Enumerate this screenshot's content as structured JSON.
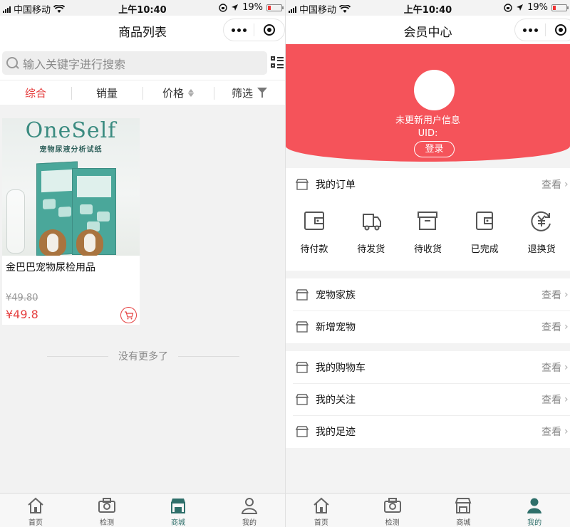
{
  "status": {
    "carrier": "中国移动",
    "time": "上午10:40",
    "battery": "19%"
  },
  "left": {
    "nav_title": "商品列表",
    "search_placeholder": "输入关键字进行搜索",
    "sort_tabs": [
      "综合",
      "销量",
      "价格",
      "筛选"
    ],
    "product": {
      "image_brand": "OneSelf",
      "image_subtitle": "宠物尿液分析试纸",
      "name": "金巴巴宠物尿检用品",
      "old_price": "¥49.80",
      "price": "¥49.8"
    },
    "no_more": "没有更多了"
  },
  "right": {
    "nav_title": "会员中心",
    "user_name": "未更新用户信息",
    "uid": "UID:",
    "login": "登录",
    "orders_title": "我的订单",
    "view": "查看",
    "order_items": [
      "待付款",
      "待发货",
      "待收货",
      "已完成",
      "退换货"
    ],
    "group1": [
      "宠物家族",
      "新增宠物"
    ],
    "group2": [
      "我的购物车",
      "我的关注",
      "我的足迹"
    ]
  },
  "tabbar": [
    "首页",
    "检测",
    "商城",
    "我的"
  ],
  "colors": {
    "accent": "#e54040",
    "hero": "#f5535a",
    "tab_active": "#2e6f6a",
    "box": "#4aa79a"
  }
}
